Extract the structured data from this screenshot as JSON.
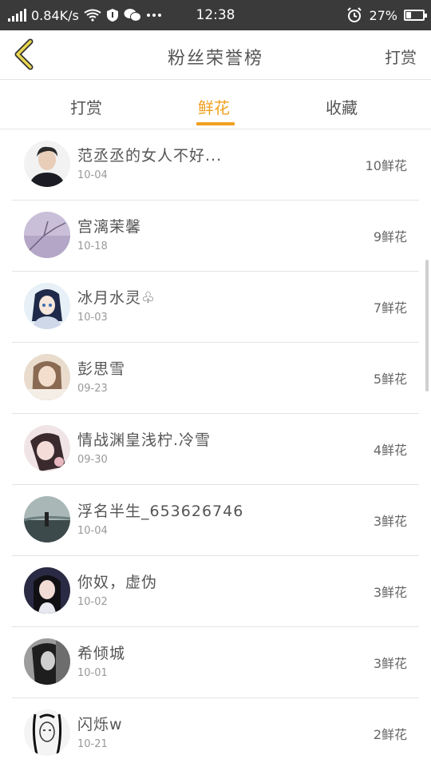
{
  "status_bar": {
    "network_speed": "0.84K/s",
    "time": "12:38",
    "battery": "27%",
    "battery_level": 0.27
  },
  "nav": {
    "title": "粉丝荣誉榜",
    "action": "打赏"
  },
  "tabs": [
    {
      "label": "打赏",
      "active": false
    },
    {
      "label": "鲜花",
      "active": true
    },
    {
      "label": "收藏",
      "active": false
    }
  ],
  "list": [
    {
      "name": "范丞丞的女人不好...",
      "date": "10-04",
      "count": "10鲜花",
      "avatar": "male-portrait"
    },
    {
      "name": "宫漓茉馨",
      "date": "10-18",
      "count": "9鲜花",
      "avatar": "purple-branch"
    },
    {
      "name": "冰月水灵♧",
      "date": "10-03",
      "count": "7鲜花",
      "avatar": "anime-girl"
    },
    {
      "name": "彭思雪",
      "date": "09-23",
      "count": "5鲜花",
      "avatar": "girl-warm"
    },
    {
      "name": "情战渊皇浅柠.冷雪",
      "date": "09-30",
      "count": "4鲜花",
      "avatar": "girl-pink"
    },
    {
      "name": "浮名半生_653626746",
      "date": "10-04",
      "count": "3鲜花",
      "avatar": "landscape"
    },
    {
      "name": "你奴，虚伪",
      "date": "10-02",
      "count": "3鲜花",
      "avatar": "girl-dark"
    },
    {
      "name": "希倾城",
      "date": "10-01",
      "count": "3鲜花",
      "avatar": "grey-portrait"
    },
    {
      "name": "闪烁w",
      "date": "10-21",
      "count": "2鲜花",
      "avatar": "sketch"
    }
  ],
  "colors": {
    "accent": "#f0a020",
    "status_bar": "#3a3a3a",
    "back_arrow_fill": "#e8d650"
  }
}
